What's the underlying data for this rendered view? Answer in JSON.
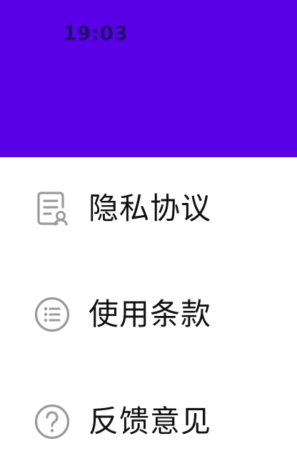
{
  "status_bar": {
    "time": "19:03"
  },
  "colors": {
    "header_background": "#5a00e6",
    "status_time": "#1f1170",
    "icon_gray": "#9a9a9a",
    "label_text": "#111111"
  },
  "menu": {
    "items": [
      {
        "label": "隐私协议",
        "icon": "privacy-document-icon"
      },
      {
        "label": "使用条款",
        "icon": "list-circle-icon"
      },
      {
        "label": "反馈意见",
        "icon": "question-circle-icon"
      }
    ]
  }
}
